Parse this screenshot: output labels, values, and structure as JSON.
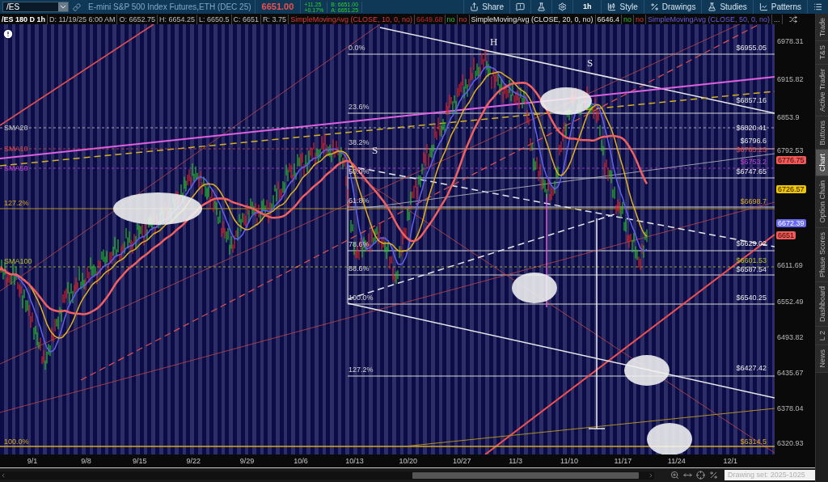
{
  "toolbar": {
    "symbol": "/ES",
    "description": "E-mini S&P 500 Index Futures,ETH (DEC 25)",
    "last": "6651.00",
    "change": "+11.25",
    "change_pct": "+0.17%",
    "bid": "B: 6651.00",
    "ask": "A: 6651.25",
    "buttons": [
      {
        "kind": "share",
        "label": "Share"
      },
      {
        "kind": "alert"
      },
      {
        "kind": "flask"
      },
      {
        "kind": "gear"
      },
      {
        "kind": "timeframe",
        "label": "1h"
      },
      {
        "kind": "style",
        "label": "Style"
      },
      {
        "kind": "drawings",
        "label": "Drawings"
      },
      {
        "kind": "studies",
        "label": "Studies"
      },
      {
        "kind": "patterns",
        "label": "Patterns"
      },
      {
        "kind": "menu"
      }
    ]
  },
  "info_bar": [
    {
      "text": "/ES 180 D 1h",
      "kind": "title"
    },
    {
      "text": "D: 11/19/25 6:00 AM",
      "kind": "quote"
    },
    {
      "text": "O: 6652.75",
      "kind": "quote"
    },
    {
      "text": "H: 6654.25",
      "kind": "quote"
    },
    {
      "text": "L: 6650.5",
      "kind": "quote"
    },
    {
      "text": "C: 6651",
      "kind": "quote"
    },
    {
      "text": "R: 3.75",
      "kind": "quote"
    },
    {
      "text": "SimpleMovingAvg (CLOSE, 10, 0, no)",
      "kind": "study10"
    },
    {
      "text": "6649.68",
      "kind": "value10"
    },
    {
      "text": "no",
      "kind": "flag_green"
    },
    {
      "text": "no",
      "kind": "flag_red"
    },
    {
      "text": "SimpleMovingAvg (CLOSE, 20, 0, no)",
      "kind": "study20"
    },
    {
      "text": "6646.4",
      "kind": "value20"
    },
    {
      "text": "no",
      "kind": "flag_green"
    },
    {
      "text": "no",
      "kind": "flag_red"
    },
    {
      "text": "SimpleMovingAvg (CLOSE, 50, 0, no)",
      "kind": "study50"
    },
    {
      "text": "...",
      "kind": "more"
    }
  ],
  "chart": {
    "pattern_labels": [
      "H",
      "S",
      "S"
    ],
    "fib_labels": [
      "0.0%",
      "23.6%",
      "38.2%",
      "50.0%",
      "61.8%",
      "78.6%",
      "88.6%",
      "100.0%",
      "127.2%"
    ],
    "left_fib_labels": [
      "127.2%",
      "100.0%"
    ],
    "sma_labels": [
      {
        "text": "SMA20",
        "kind": "sma20"
      },
      {
        "text": "SMA10",
        "kind": "sma10"
      },
      {
        "text": "SMA50",
        "kind": "sma50"
      },
      {
        "text": "SMA100",
        "kind": "sma100"
      }
    ],
    "price_labels": [
      {
        "text": "$6955.05",
        "kind": "fib"
      },
      {
        "text": "$6857.16",
        "kind": "fib"
      },
      {
        "text": "$6820.41",
        "kind": "fib"
      },
      {
        "text": "$6796.6",
        "kind": "fib"
      },
      {
        "text": "$6785.23",
        "kind": "sma10"
      },
      {
        "text": "$6753.2",
        "kind": "sma50"
      },
      {
        "text": "$6747.65",
        "kind": "fib"
      },
      {
        "text": "$6698.7",
        "kind": "gold"
      },
      {
        "text": "$6629.02",
        "kind": "fib"
      },
      {
        "text": "$6601.53",
        "kind": "sma100"
      },
      {
        "text": "$6587.54",
        "kind": "fib"
      },
      {
        "text": "$6540.25",
        "kind": "fib"
      },
      {
        "text": "$6427.42",
        "kind": "fib"
      },
      {
        "text": "$6314.5",
        "kind": "gold"
      }
    ]
  },
  "price_axis": {
    "ticks": [
      "6978.31",
      "6915.82",
      "6853.9",
      "6792.53",
      "6611.69",
      "6552.49",
      "6493.82",
      "6435.67",
      "6378.04",
      "6320.93"
    ],
    "badges": [
      {
        "text": "6776.75",
        "color": "#f05a5a"
      },
      {
        "text": "6726.57",
        "color": "#e8c800"
      },
      {
        "text": "6672.39",
        "color": "#6a6af0"
      },
      {
        "text": "6651",
        "color": "#f05a5a"
      }
    ]
  },
  "date_axis": [
    "9/1",
    "9/8",
    "9/15",
    "9/22",
    "9/29",
    "10/6",
    "10/13",
    "10/20",
    "10/27",
    "11/3",
    "11/10",
    "11/17",
    "11/24",
    "12/1"
  ],
  "drawing_set": "Drawing set: 2025-1025",
  "side_tabs": [
    {
      "label": "Trade",
      "selected": false
    },
    {
      "label": "T&S",
      "selected": false
    },
    {
      "label": "Active Trader",
      "selected": false
    },
    {
      "label": "Buttons",
      "selected": false
    },
    {
      "label": "Chart",
      "selected": true
    },
    {
      "label": "Option Chain",
      "selected": false
    },
    {
      "label": "Phase Scores",
      "selected": false
    },
    {
      "label": "Dashboard",
      "selected": false
    },
    {
      "label": "L 2",
      "selected": false
    },
    {
      "label": "News",
      "selected": false
    }
  ]
}
